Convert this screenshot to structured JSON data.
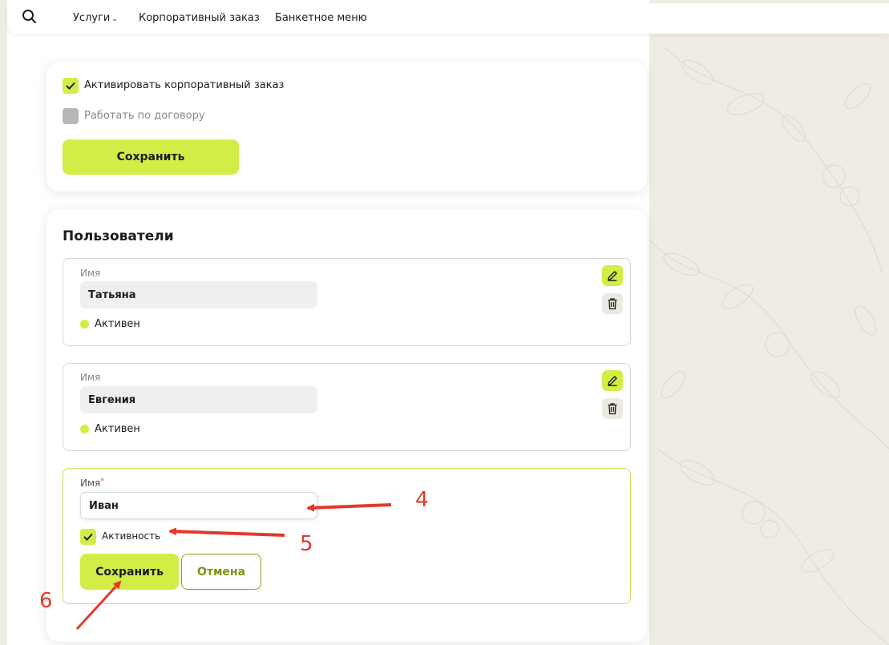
{
  "nav": {
    "items": [
      {
        "label": "Услуги",
        "has_dropdown": true
      },
      {
        "label": "Корпоративный заказ"
      },
      {
        "label": "Банкетное меню"
      }
    ]
  },
  "settings": {
    "activate_label": "Активировать корпоративный заказ",
    "activate_checked": true,
    "contract_label": "Работать по договору",
    "contract_checked": false,
    "save_label": "Сохранить"
  },
  "users": {
    "title": "Пользователи",
    "list": [
      {
        "name_label": "Имя",
        "name": "Татьяна",
        "status": "Активен"
      },
      {
        "name_label": "Имя",
        "name": "Евгения",
        "status": "Активен"
      }
    ],
    "new_user": {
      "name_label": "Имя",
      "required_mark": "*",
      "name_value": "Иван",
      "activity_label": "Активность",
      "activity_checked": true,
      "save_label": "Сохранить",
      "cancel_label": "Отмена"
    }
  },
  "annotations": [
    "4",
    "5",
    "6"
  ],
  "colors": {
    "accent": "#d4ec46",
    "accent_dark": "#7d9412",
    "annotation_red": "#e03a2b",
    "page_bg": "#efece3"
  }
}
